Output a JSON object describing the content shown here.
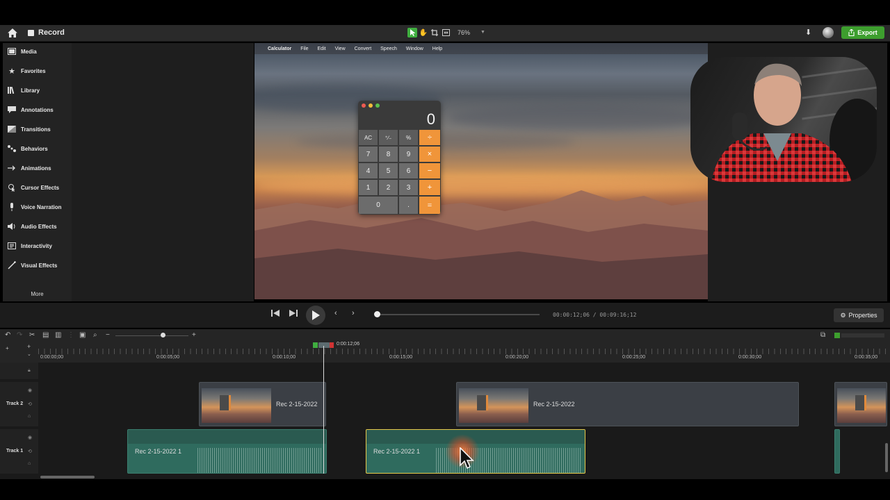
{
  "app": {
    "project_label": "Record",
    "zoom": "76%",
    "export_label": "Export"
  },
  "sidebar": {
    "items": [
      {
        "label": "Media",
        "icon": "film-icon"
      },
      {
        "label": "Favorites",
        "icon": "star-icon"
      },
      {
        "label": "Library",
        "icon": "library-icon"
      },
      {
        "label": "Annotations",
        "icon": "annotation-icon"
      },
      {
        "label": "Transitions",
        "icon": "transition-icon"
      },
      {
        "label": "Behaviors",
        "icon": "behavior-icon"
      },
      {
        "label": "Animations",
        "icon": "animation-icon"
      },
      {
        "label": "Cursor Effects",
        "icon": "cursor-icon"
      },
      {
        "label": "Voice Narration",
        "icon": "microphone-icon"
      },
      {
        "label": "Audio Effects",
        "icon": "speaker-icon"
      },
      {
        "label": "Interactivity",
        "icon": "interactivity-icon"
      },
      {
        "label": "Visual Effects",
        "icon": "wand-icon"
      }
    ],
    "more_label": "More"
  },
  "canvas": {
    "menubar": [
      "Calculator",
      "File",
      "Edit",
      "View",
      "Convert",
      "Speech",
      "Window",
      "Help"
    ],
    "calculator": {
      "display": "0",
      "rows": [
        [
          "AC",
          "⁺∕₋",
          "%",
          "÷"
        ],
        [
          "7",
          "8",
          "9",
          "×"
        ],
        [
          "4",
          "5",
          "6",
          "−"
        ],
        [
          "1",
          "2",
          "3",
          "+"
        ],
        [
          "0",
          ".",
          "="
        ]
      ]
    }
  },
  "playback": {
    "timecode": "00:00:12;06 / 00:09:16;12",
    "properties_label": "Properties",
    "progress": 0.0
  },
  "ruler": {
    "labels": [
      "0:00:00;00",
      "0:00:05;00",
      "0:00:10;00",
      "0:00:15;00",
      "0:00:20;00",
      "0:00:25;00",
      "0:00:30;00",
      "0:00:35;00"
    ],
    "playhead_time": "0:00:12;06"
  },
  "tracks": {
    "track2": {
      "name": "Track 2",
      "clips": [
        "Rec 2-15-2022",
        "Rec 2-15-2022"
      ]
    },
    "track1": {
      "name": "Track 1",
      "clips": [
        "Rec 2-15-2022 1",
        "Rec 2-15-2022 1"
      ]
    }
  },
  "colors": {
    "accent_green": "#3d9e2e",
    "calc_orange": "#f0953a",
    "audio_clip": "#2f6b5e"
  }
}
